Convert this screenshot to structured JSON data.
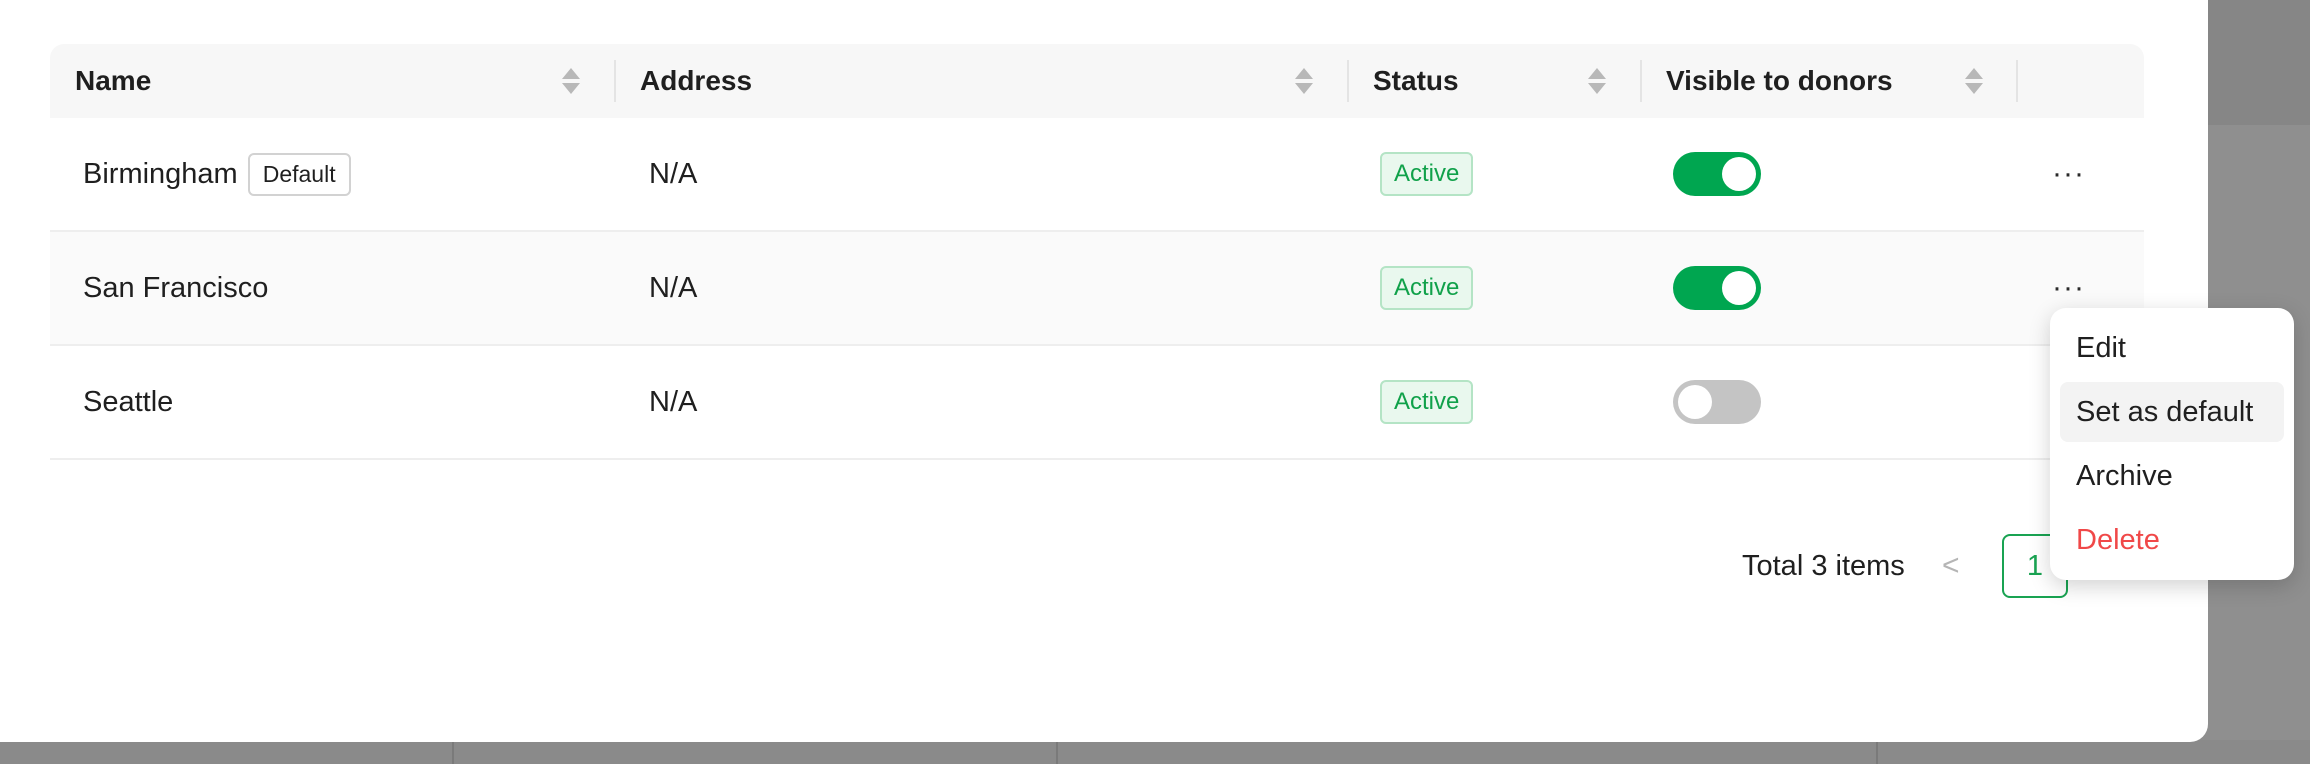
{
  "table": {
    "columns": [
      "Name",
      "Address",
      "Status",
      "Visible to donors"
    ],
    "rows": [
      {
        "name": "Birmingham",
        "badge": "Default",
        "address": "N/A",
        "status": "Active",
        "visible": true
      },
      {
        "name": "San Francisco",
        "badge": "",
        "address": "N/A",
        "status": "Active",
        "visible": true
      },
      {
        "name": "Seattle",
        "badge": "",
        "address": "N/A",
        "status": "Active",
        "visible": false
      }
    ],
    "more_label": "···"
  },
  "pagination": {
    "total": "Total 3 items",
    "prev": "<",
    "current": "1"
  },
  "menu": {
    "items": [
      "Edit",
      "Set as default",
      "Archive",
      "Delete"
    ]
  },
  "colors": {
    "accent": "#00a650",
    "danger": "#f04848",
    "status_bg": "#e9f8ee"
  },
  "icons": {
    "sort": "sort-icon",
    "more": "more-horizontal-icon",
    "prev": "chevron-left-icon"
  }
}
